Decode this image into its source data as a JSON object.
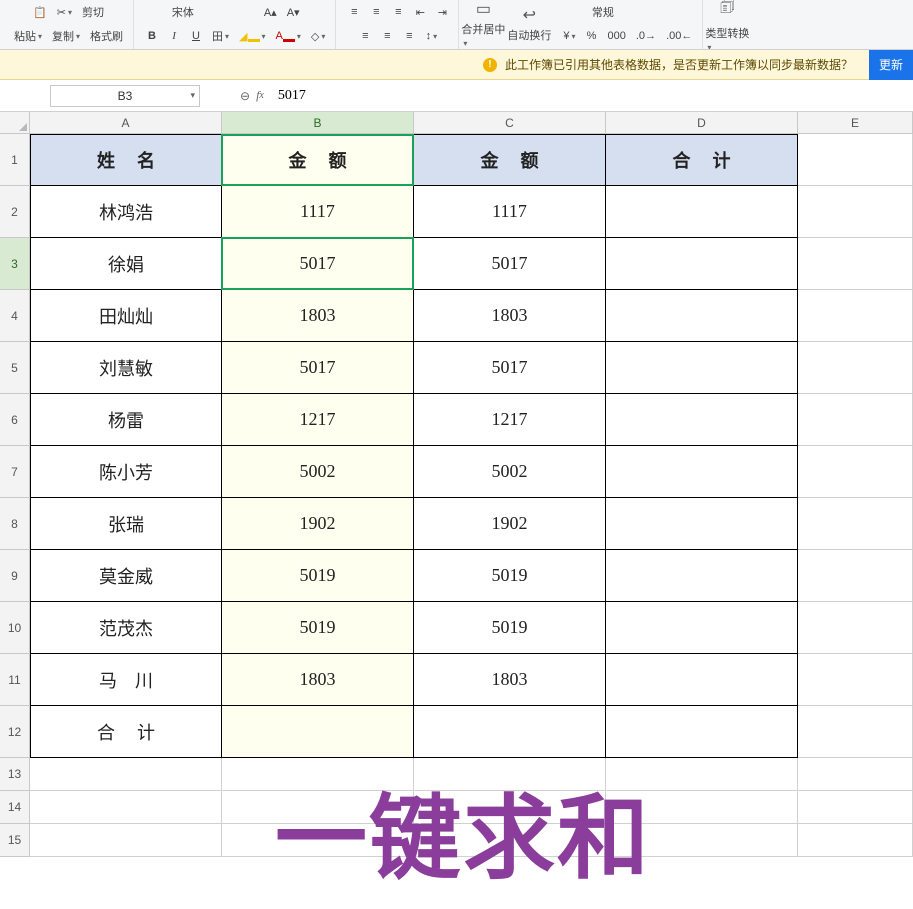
{
  "ribbon": {
    "paste": "粘贴",
    "cut": "剪切",
    "copy": "复制",
    "format_painter": "格式刷",
    "font_family": "宋体",
    "merge_center": "合并居中",
    "wrap_text": "自动换行",
    "general_fmt": "常规",
    "type_convert": "类型转换"
  },
  "notice": {
    "text": "此工作簿已引用其他表格数据，是否更新工作簿以同步最新数据？",
    "update": "更新"
  },
  "formula_bar": {
    "namebox": "B3",
    "formula": "5017"
  },
  "columns": {
    "a": "A",
    "b": "B",
    "c": "C",
    "d": "D",
    "e": "E"
  },
  "rowNums": [
    "1",
    "2",
    "3",
    "4",
    "5",
    "6",
    "7",
    "8",
    "9",
    "10",
    "11",
    "12",
    "13",
    "14",
    "15"
  ],
  "headers": {
    "name": "姓名",
    "amount1": "金额",
    "amount2": "金额",
    "total": "合计"
  },
  "rows": [
    {
      "name": "林鸿浩",
      "b": "1117",
      "c": "1117",
      "d": ""
    },
    {
      "name": "徐娟",
      "b": "5017",
      "c": "5017",
      "d": ""
    },
    {
      "name": "田灿灿",
      "b": "1803",
      "c": "1803",
      "d": ""
    },
    {
      "name": "刘慧敏",
      "b": "5017",
      "c": "5017",
      "d": ""
    },
    {
      "name": "杨雷",
      "b": "1217",
      "c": "1217",
      "d": ""
    },
    {
      "name": "陈小芳",
      "b": "5002",
      "c": "5002",
      "d": ""
    },
    {
      "name": "张瑞",
      "b": "1902",
      "c": "1902",
      "d": ""
    },
    {
      "name": "莫金威",
      "b": "5019",
      "c": "5019",
      "d": ""
    },
    {
      "name": "范茂杰",
      "b": "5019",
      "c": "5019",
      "d": ""
    },
    {
      "name": "马　川",
      "b": "1803",
      "c": "1803",
      "d": ""
    }
  ],
  "footer": {
    "label": "合计"
  },
  "watermark": "一键求和"
}
